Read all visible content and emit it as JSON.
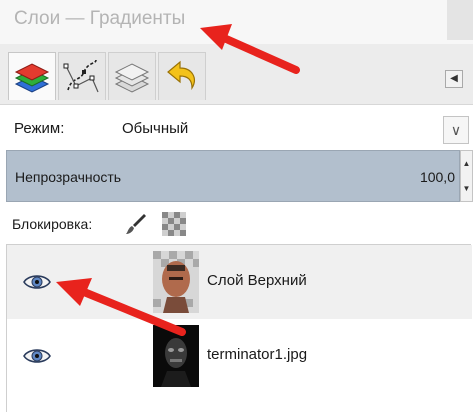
{
  "window": {
    "title": "Слои — Градиенты"
  },
  "tabs": [
    {
      "name": "layers-icon"
    },
    {
      "name": "paths-icon"
    },
    {
      "name": "channels-icon"
    },
    {
      "name": "undo-history-icon"
    }
  ],
  "tab_menu": {
    "icon": "triangle-left-icon",
    "glyph": "◀"
  },
  "mode": {
    "label": "Режим:",
    "value": "Обычный",
    "dropdown_glyph": "∨"
  },
  "opacity": {
    "label": "Непрозрачность",
    "value": "100,0"
  },
  "lock": {
    "label": "Блокировка:"
  },
  "layers": [
    {
      "name": "Слой Верхний",
      "visible": true,
      "selected": true
    },
    {
      "name": "terminator1.jpg",
      "visible": true,
      "selected": false
    }
  ],
  "colors": {
    "arrow": "#e8231d",
    "opacity_bg": "#b2bfcd",
    "selected_row": "#f0f0f0"
  }
}
